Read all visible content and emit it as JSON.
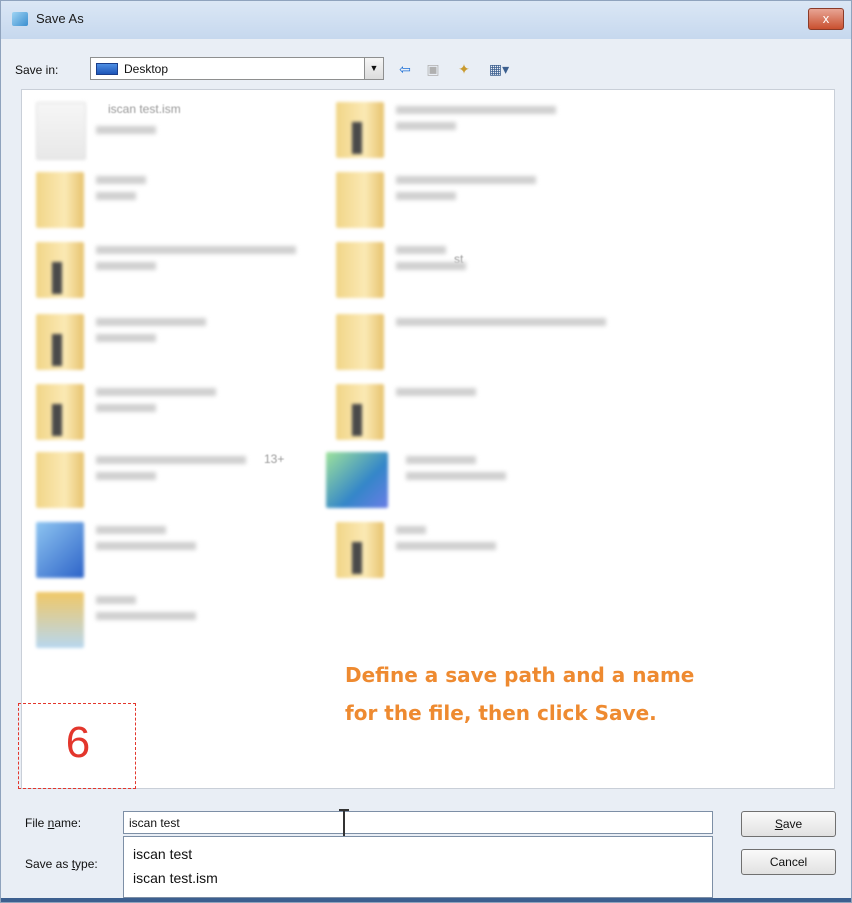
{
  "window": {
    "title": "Save As",
    "close_label": "x"
  },
  "toolbar": {
    "savein_label": "Save in:",
    "location": "Desktop",
    "icons": [
      "back-arrow-icon",
      "up-folder-icon",
      "new-folder-icon",
      "view-menu-icon"
    ]
  },
  "files": [
    {
      "name": "iscan test.ism",
      "icon": "document-icon"
    },
    {
      "name": "",
      "icon": "folder-icon"
    },
    {
      "name": "",
      "icon": "folder-icon"
    },
    {
      "name": "",
      "icon": "folder-icon"
    },
    {
      "name": "",
      "icon": "folder-icon"
    },
    {
      "name": "st",
      "icon": "folder-icon"
    },
    {
      "name": "",
      "icon": "folder-icon"
    },
    {
      "name": "",
      "icon": "folder-icon"
    },
    {
      "name": "",
      "icon": "folder-icon"
    },
    {
      "name": "",
      "icon": "folder-icon"
    },
    {
      "name": "13+",
      "icon": "folder-icon"
    },
    {
      "name": "",
      "icon": "network-icon"
    },
    {
      "name": "",
      "icon": "computer-icon"
    },
    {
      "name": "",
      "icon": "folder-icon"
    },
    {
      "name": "",
      "icon": "libraries-icon"
    }
  ],
  "annotation": {
    "line1": "Define a save path and a name",
    "line2": "for the file, then click Save.",
    "color": "#ee8a30"
  },
  "step": {
    "number": "6",
    "color": "#e3362c"
  },
  "footer": {
    "filename_label_pre": "File ",
    "filename_label_u": "n",
    "filename_label_post": "ame:",
    "filename_value": "iscan test",
    "savetype_label_pre": "Save as ",
    "savetype_label_u": "t",
    "savetype_label_post": "ype:",
    "autocomplete": [
      "iscan test",
      "iscan test.ism"
    ],
    "save_u": "S",
    "save_rest": "ave",
    "cancel_label": "Cancel"
  }
}
